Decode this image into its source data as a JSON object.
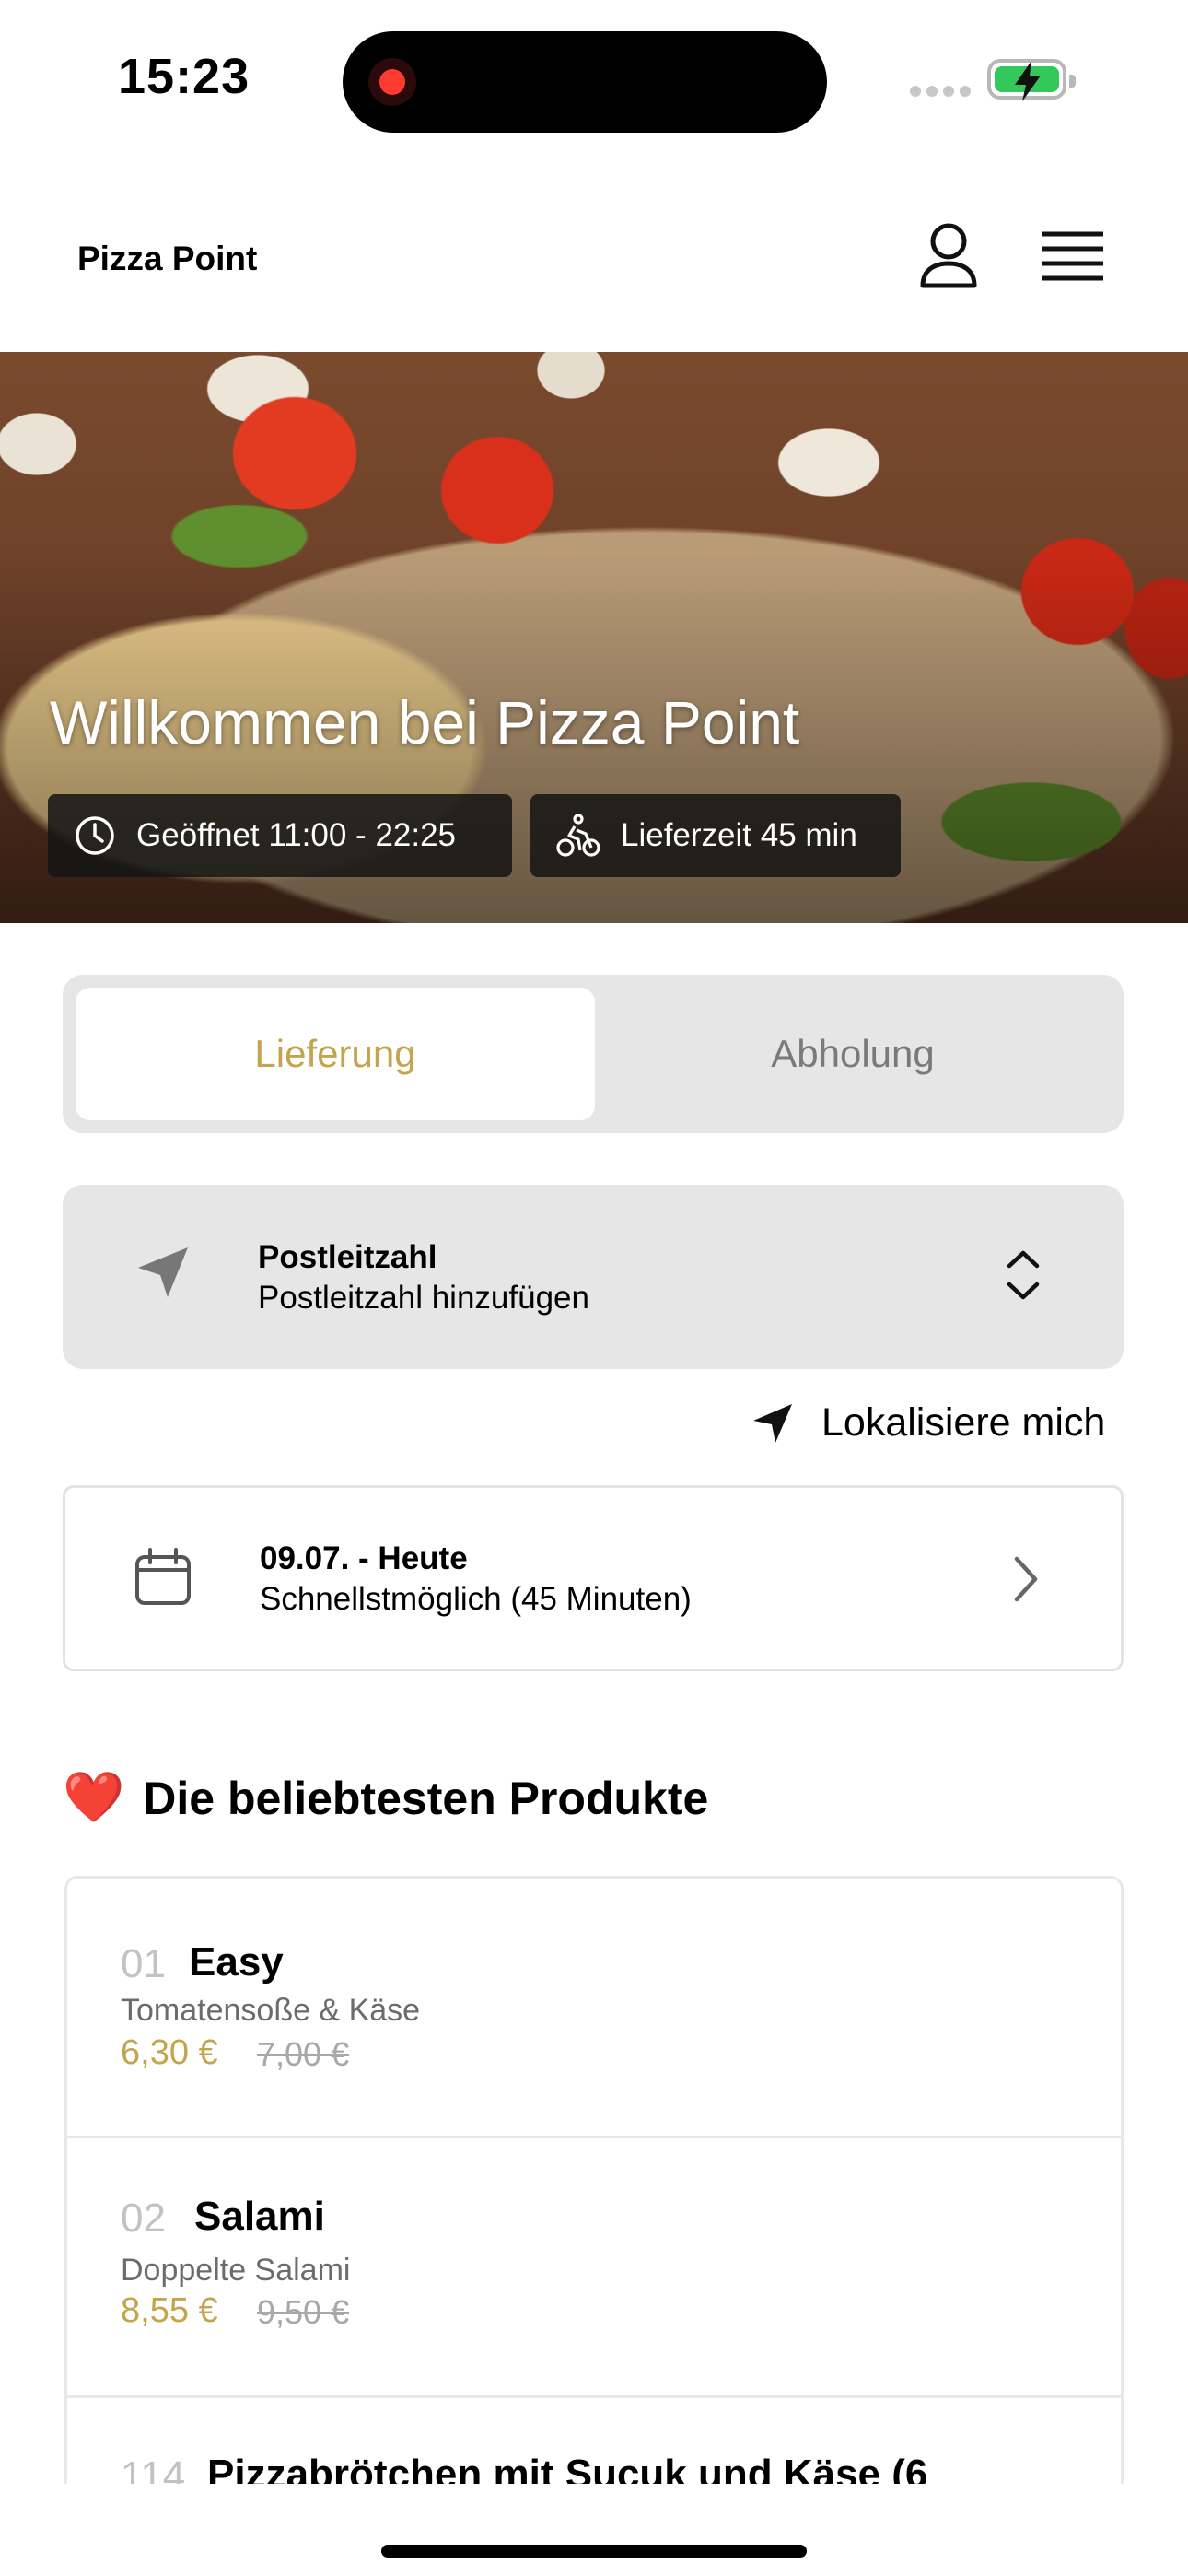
{
  "status_bar": {
    "time": "15:23"
  },
  "header": {
    "brand": "Pizza Point"
  },
  "hero": {
    "title": "Willkommen bei Pizza Point",
    "opening_hours": "Geöffnet 11:00 - 22:25",
    "delivery_time": "Lieferzeit 45 min"
  },
  "mode_tabs": {
    "delivery": "Lieferung",
    "pickup": "Abholung",
    "selected": "Lieferung"
  },
  "postcode": {
    "label": "Postleitzahl",
    "placeholder": "Postleitzahl hinzufügen"
  },
  "locate_label": "Lokalisiere mich",
  "schedule": {
    "date": "09.07. - Heute",
    "time": "Schnellstmöglich (45 Minuten)"
  },
  "popular": {
    "heading": "Die beliebtesten Produkte",
    "heading_emoji": "❤️",
    "items": [
      {
        "num": "01",
        "name": "Easy",
        "desc": "Tomatensoße & Käse",
        "price": "6,30 €",
        "old_price": "7,00 €"
      },
      {
        "num": "02",
        "name": "Salami",
        "desc": "Doppelte Salami",
        "price": "8,55 €",
        "old_price": "9,50 €"
      },
      {
        "num": "114",
        "name": "Pizzabrötchen mit Sucuk und Käse (6"
      }
    ]
  },
  "colors": {
    "accent": "#c4a44c",
    "segment_bg": "#e6e6e6",
    "battery": "#34c759"
  }
}
